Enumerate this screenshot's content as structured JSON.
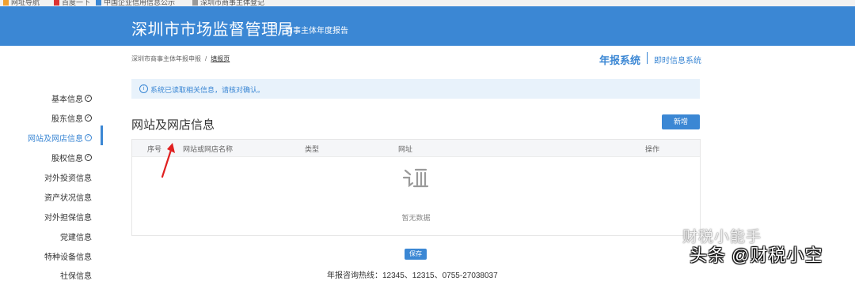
{
  "bookmarks": [
    "网址导航",
    "百度一下",
    "中国企业信用信息公示",
    "深圳市商事主体登记"
  ],
  "header": {
    "title": "深圳市市场监督管理局",
    "subtitle": "商事主体年度报告",
    "color": "#3b87d4"
  },
  "breadcrumb": {
    "root": "深圳市商事主体年报申报",
    "separator": "/",
    "current": "填报页"
  },
  "systems": {
    "annual": "年报系统",
    "instant": "即时信息系统"
  },
  "sidebar": {
    "items": [
      {
        "label": "基本信息",
        "checked": true
      },
      {
        "label": "股东信息",
        "checked": true
      },
      {
        "label": "网站及网店信息",
        "checked": true,
        "active": true
      },
      {
        "label": "股权信息",
        "checked": true
      },
      {
        "label": "对外投资信息",
        "checked": false
      },
      {
        "label": "资产状况信息",
        "checked": false
      },
      {
        "label": "对外担保信息",
        "checked": false
      },
      {
        "label": "党建信息",
        "checked": false
      },
      {
        "label": "特种设备信息",
        "checked": false
      },
      {
        "label": "社保信息",
        "checked": false
      }
    ]
  },
  "alert": {
    "icon": "info-icon",
    "text": "系统已读取相关信息，请核对确认。"
  },
  "section": {
    "title": "网站及网店信息",
    "add_label": "新增"
  },
  "table": {
    "columns": [
      "序号",
      "网站或网店名称",
      "类型",
      "网址",
      "操作"
    ],
    "rows": [],
    "empty_text": "暂无数据"
  },
  "save_label": "保存",
  "footer": {
    "hotline": "年报咨询热线：12345、12315、0755-27038037"
  },
  "watermarks": {
    "line1": "财税小能手",
    "line2": "头条 @财税小空"
  }
}
